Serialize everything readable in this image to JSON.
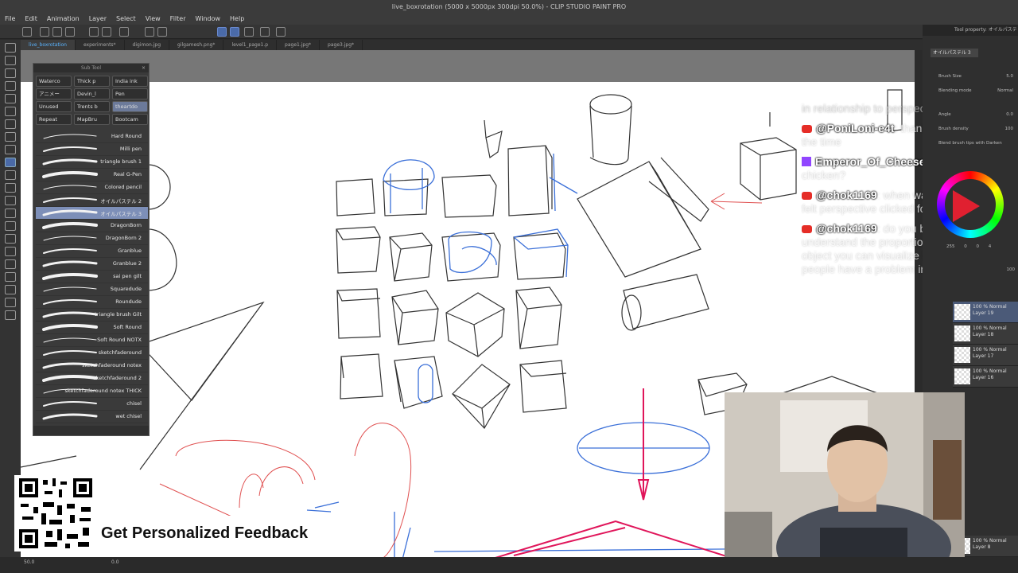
{
  "window": {
    "title": "live_boxrotation (5000 x 5000px 300dpi 50.0%)  - CLIP STUDIO PAINT PRO"
  },
  "menu": [
    "File",
    "Edit",
    "Animation",
    "Layer",
    "Select",
    "View",
    "Filter",
    "Window",
    "Help"
  ],
  "tabs": [
    "live_boxrotation",
    "experiments*",
    "digimon.jpg",
    "gilgamesh.png*",
    "level1_page1.p",
    "page1.jpg*",
    "page3.jpg*"
  ],
  "subtool": {
    "title": "Sub Tool",
    "groups": [
      "Waterco",
      "Thick p",
      "India ink",
      "アニメー",
      "Devin_l",
      "Pen",
      "Unused",
      "Trents b",
      "theartdo",
      "Repeat",
      "MapBru",
      "Bootcam"
    ],
    "selected_group": "theartdo",
    "brushes": [
      "Hard Round",
      "Milli pen",
      "triangle brush 1",
      "Real G-Pen",
      "Colored pencil",
      "オイルパステル 2",
      "オイルパステル 3",
      "DragonBorn",
      "DragonBorn 2",
      "Granblue",
      "Granblue 2",
      "sai pen gilt",
      "Squaredude",
      "Roundude",
      "triangle brush Gilt",
      "Soft Round",
      "Soft Round NOTX",
      "sketchfaderound",
      "sketchfaderound notex",
      "sketchfaderound 2",
      "sketchfaderound notex THICK",
      "chisel",
      "wet chisel"
    ],
    "selected_brush": "オイルパステル 3"
  },
  "tool_property": {
    "header": "Tool property: オイルパステ",
    "selected_tool": "オイルパステル 3",
    "brush_size_label": "Brush Size",
    "brush_size_value": "5.0",
    "blending_label": "Blending mode",
    "blending_value": "Normal",
    "angle_label": "Angle",
    "angle_value": "0.0",
    "density_label": "Brush density",
    "density_value": "100",
    "blend_tips": "Blend brush tips with Darken"
  },
  "color": {
    "r": "255",
    "g": "0",
    "b": "0",
    "opacity": "4"
  },
  "layers": [
    {
      "mode": "100 % Normal",
      "name": "Layer 19",
      "selected": true
    },
    {
      "mode": "100 % Normal",
      "name": "Layer 18",
      "selected": false
    },
    {
      "mode": "100 % Normal",
      "name": "Layer 17",
      "selected": false
    },
    {
      "mode": "100 % Normal",
      "name": "Layer 16",
      "selected": false
    },
    {
      "mode": "100 % Normal",
      "name": "Layer 8",
      "selected": false
    }
  ],
  "layer_opacity": "100",
  "chat": [
    {
      "user": "",
      "message": "in relationship to perspective?",
      "platform": ""
    },
    {
      "user": "@PoniLoni-e4t",
      "message": ": thank you so much for the time",
      "platform": "youtube"
    },
    {
      "user": "Emperor_Of_Cheese",
      "message": ": what about a chicken?",
      "platform": "twitch"
    },
    {
      "user": "@chok1169",
      "message": ": when was the time you felt perspective clicked for you",
      "platform": "youtube"
    },
    {
      "user": "@chok1169",
      "message": ": do you believe that if you understand the proportions and form of a object you can visualize it? i heard some people have a problem in that area",
      "platform": "youtube"
    }
  ],
  "status": {
    "zoom": "50.0",
    "rotation": "0.0"
  },
  "promo": {
    "text": "Get Personalized Feedback"
  },
  "colors": {
    "accent": "#5ab4ff",
    "chat_youtube": "#e52d27",
    "chat_twitch": "#9146ff",
    "sketch_blue": "#3a6fd8",
    "sketch_red": "#e0155a"
  }
}
